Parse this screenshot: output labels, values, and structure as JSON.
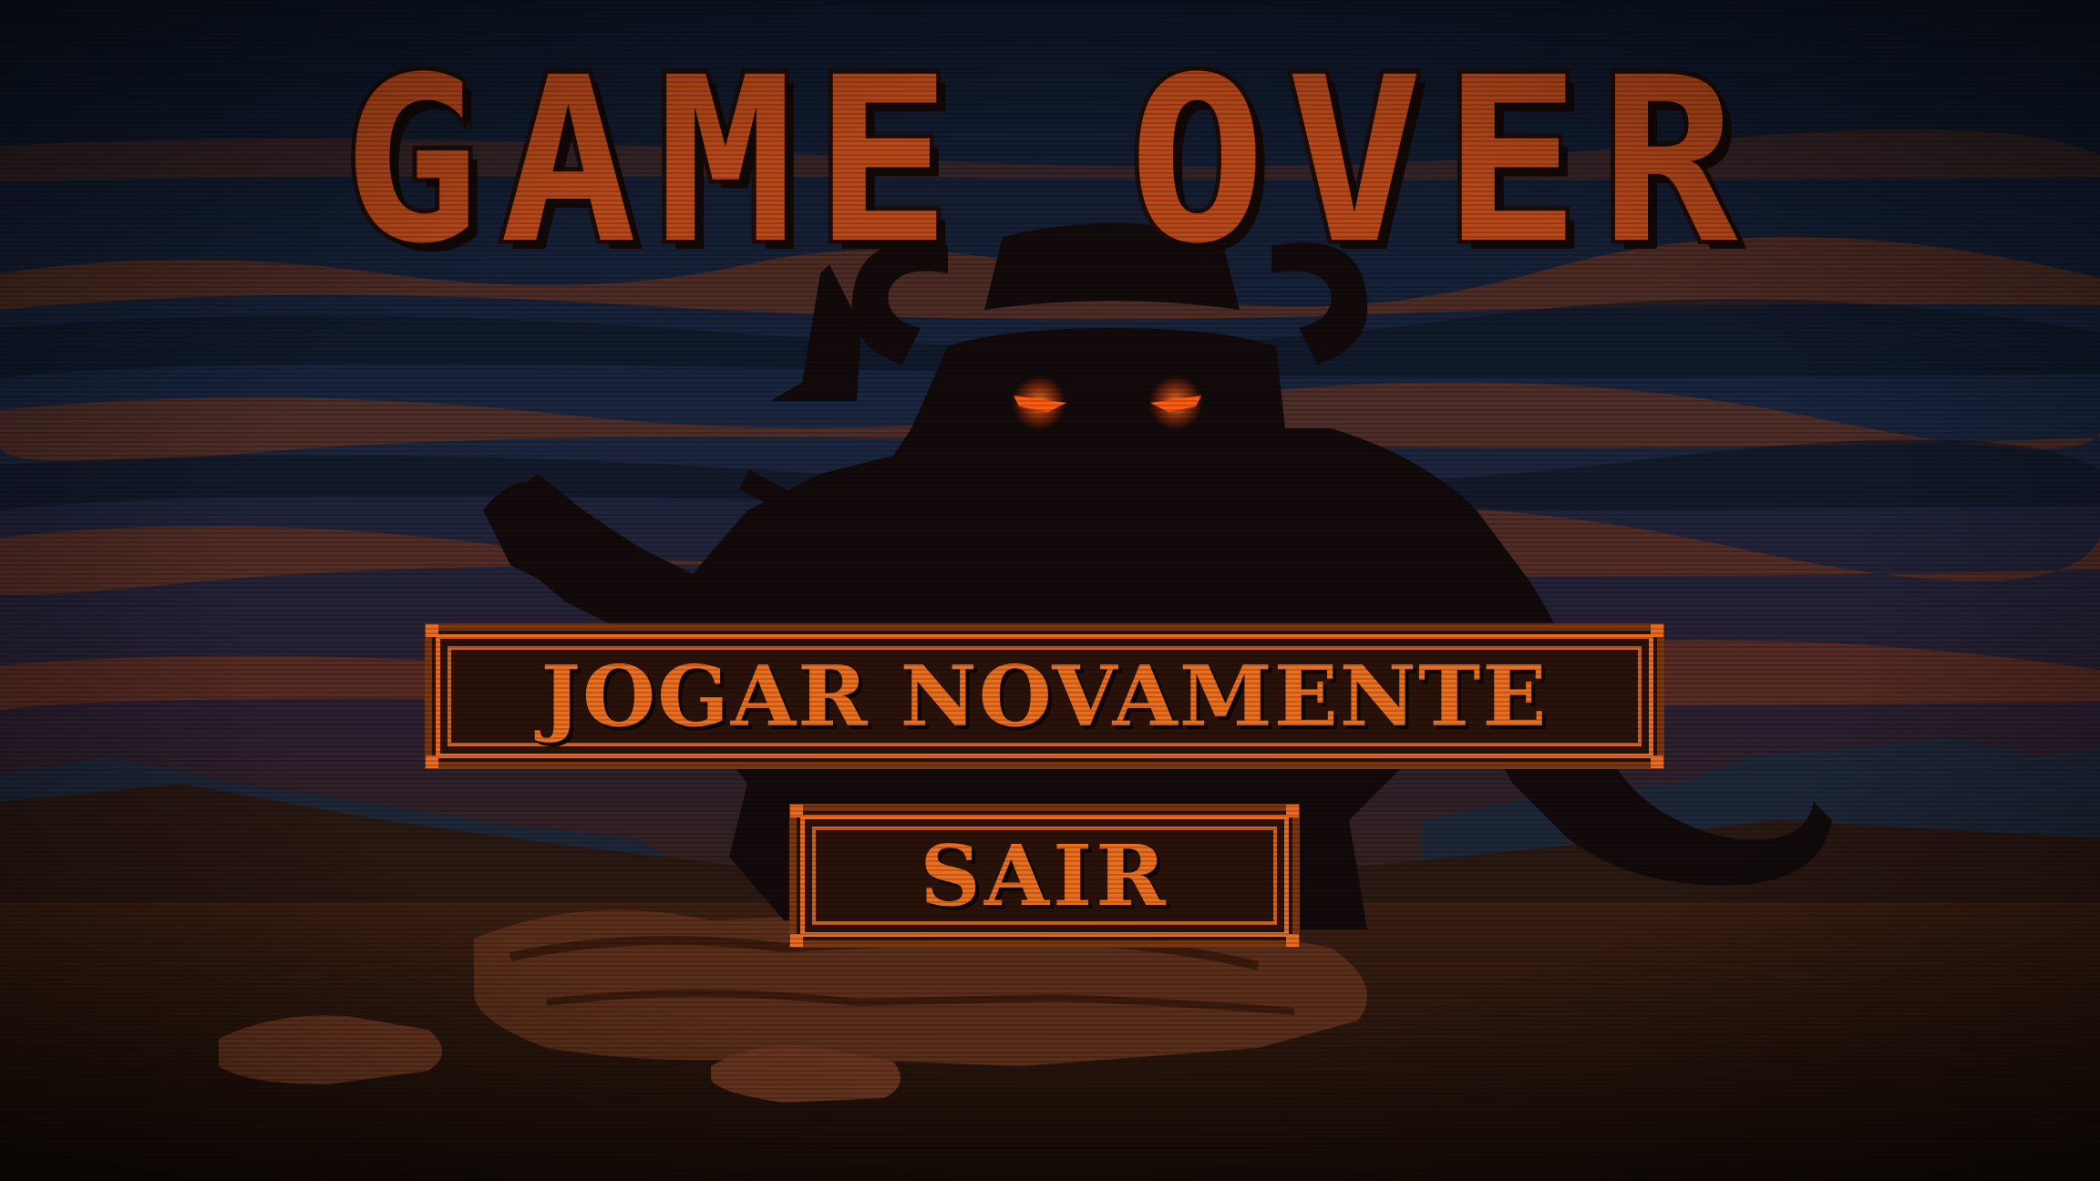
{
  "screen": {
    "title": "GAME OVER",
    "background": "dusk-battlefield-scene",
    "character": "horned-demon-silhouette-with-sword",
    "fallen": "defeated-hero-body"
  },
  "menu": {
    "play_again_label": "JOGAR NOVAMENTE",
    "quit_label": "SAIR"
  },
  "colors": {
    "accent": "#ea6a1f",
    "title": "#b8481a",
    "button_bg": "#2a120a",
    "eyes": "#ff4a10",
    "sky": "#16233a"
  }
}
